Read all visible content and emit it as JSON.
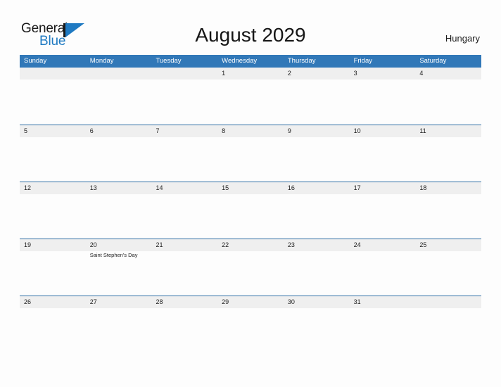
{
  "brand": {
    "name_part1": "General",
    "name_part2": "Blue",
    "logo_icon": "triangle-flag-icon",
    "accent_color": "#1f7ac2"
  },
  "header": {
    "title": "August 2029",
    "country": "Hungary"
  },
  "calendar": {
    "header_color": "#3178b8",
    "band_color": "#efefef",
    "row_border_color": "#2e6da4",
    "weekday_headers": [
      "Sunday",
      "Monday",
      "Tuesday",
      "Wednesday",
      "Thursday",
      "Friday",
      "Saturday"
    ],
    "weeks": [
      {
        "days": [
          {
            "num": "",
            "event": ""
          },
          {
            "num": "",
            "event": ""
          },
          {
            "num": "",
            "event": ""
          },
          {
            "num": "1",
            "event": ""
          },
          {
            "num": "2",
            "event": ""
          },
          {
            "num": "3",
            "event": ""
          },
          {
            "num": "4",
            "event": ""
          }
        ]
      },
      {
        "days": [
          {
            "num": "5",
            "event": ""
          },
          {
            "num": "6",
            "event": ""
          },
          {
            "num": "7",
            "event": ""
          },
          {
            "num": "8",
            "event": ""
          },
          {
            "num": "9",
            "event": ""
          },
          {
            "num": "10",
            "event": ""
          },
          {
            "num": "11",
            "event": ""
          }
        ]
      },
      {
        "days": [
          {
            "num": "12",
            "event": ""
          },
          {
            "num": "13",
            "event": ""
          },
          {
            "num": "14",
            "event": ""
          },
          {
            "num": "15",
            "event": ""
          },
          {
            "num": "16",
            "event": ""
          },
          {
            "num": "17",
            "event": ""
          },
          {
            "num": "18",
            "event": ""
          }
        ]
      },
      {
        "days": [
          {
            "num": "19",
            "event": ""
          },
          {
            "num": "20",
            "event": "Saint Stephen's Day"
          },
          {
            "num": "21",
            "event": ""
          },
          {
            "num": "22",
            "event": ""
          },
          {
            "num": "23",
            "event": ""
          },
          {
            "num": "24",
            "event": ""
          },
          {
            "num": "25",
            "event": ""
          }
        ]
      },
      {
        "days": [
          {
            "num": "26",
            "event": ""
          },
          {
            "num": "27",
            "event": ""
          },
          {
            "num": "28",
            "event": ""
          },
          {
            "num": "29",
            "event": ""
          },
          {
            "num": "30",
            "event": ""
          },
          {
            "num": "31",
            "event": ""
          },
          {
            "num": "",
            "event": ""
          }
        ]
      }
    ]
  }
}
